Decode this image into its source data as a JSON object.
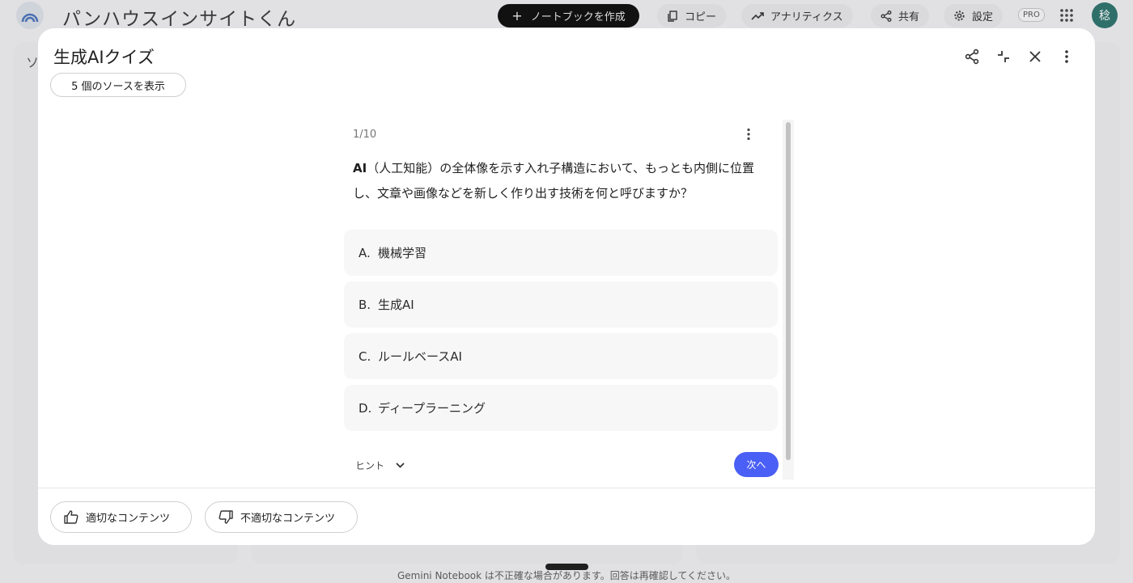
{
  "app": {
    "title": "パンハウスインサイトくん",
    "create_notebook": "ノートブックを作成",
    "copy": "コピー",
    "analytics": "アナリティクス",
    "share": "共有",
    "settings": "設定",
    "pro_badge": "PRO",
    "avatar_initial": "稔",
    "background_panel_char": "ソ",
    "footer_notice": "Gemini Notebook は不正確な場合があります。回答は再確認してください。"
  },
  "modal": {
    "title": "生成AIクイズ",
    "sources_button": "5 個のソースを表示",
    "header_icons": [
      "share-icon",
      "collapse-icon",
      "close-icon",
      "more-vert-icon"
    ]
  },
  "quiz": {
    "progress": "1/10",
    "question_strong": "AI",
    "question_rest": "（人工知能）の全体像を示す入れ子構造において、もっとも内側に位置し、文章や画像などを新しく作り出す技術を何と呼びますか？",
    "options": [
      {
        "letter": "A.",
        "text": "機械学習"
      },
      {
        "letter": "B.",
        "text": "生成AI"
      },
      {
        "letter": "C.",
        "text": "ルールベースAI"
      },
      {
        "letter": "D.",
        "text": "ディープラーニング"
      }
    ],
    "hint_label": "ヒント",
    "next_label": "次へ"
  },
  "feedback": {
    "good": "適切なコンテンツ",
    "bad": "不適切なコンテンツ"
  },
  "colors": {
    "accent": "#4a5ff5",
    "modal_bg": "#ffffff",
    "option_bg": "#f7f7f7",
    "backdrop": "#e1e1e4"
  }
}
